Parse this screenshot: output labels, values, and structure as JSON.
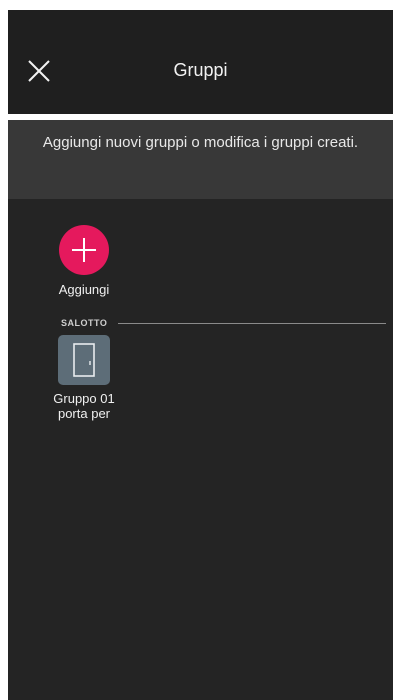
{
  "header": {
    "title": "Gruppi",
    "close_icon": "close-icon"
  },
  "banner": {
    "text": "Aggiungi nuovi gruppi o modifica i gruppi creati."
  },
  "add": {
    "label": "Aggiungi",
    "icon": "plus-icon",
    "color": "#e5195d"
  },
  "sections": [
    {
      "title": "SALOTTO",
      "groups": [
        {
          "label_line1": "Gruppo 01",
          "label_line2": "porta per",
          "icon": "door-icon",
          "icon_bg": "#5d6d78"
        }
      ]
    }
  ],
  "colors": {
    "background": "#242424",
    "header_bg": "#1f1f1f",
    "banner_bg": "#383838",
    "accent": "#e5195d"
  }
}
